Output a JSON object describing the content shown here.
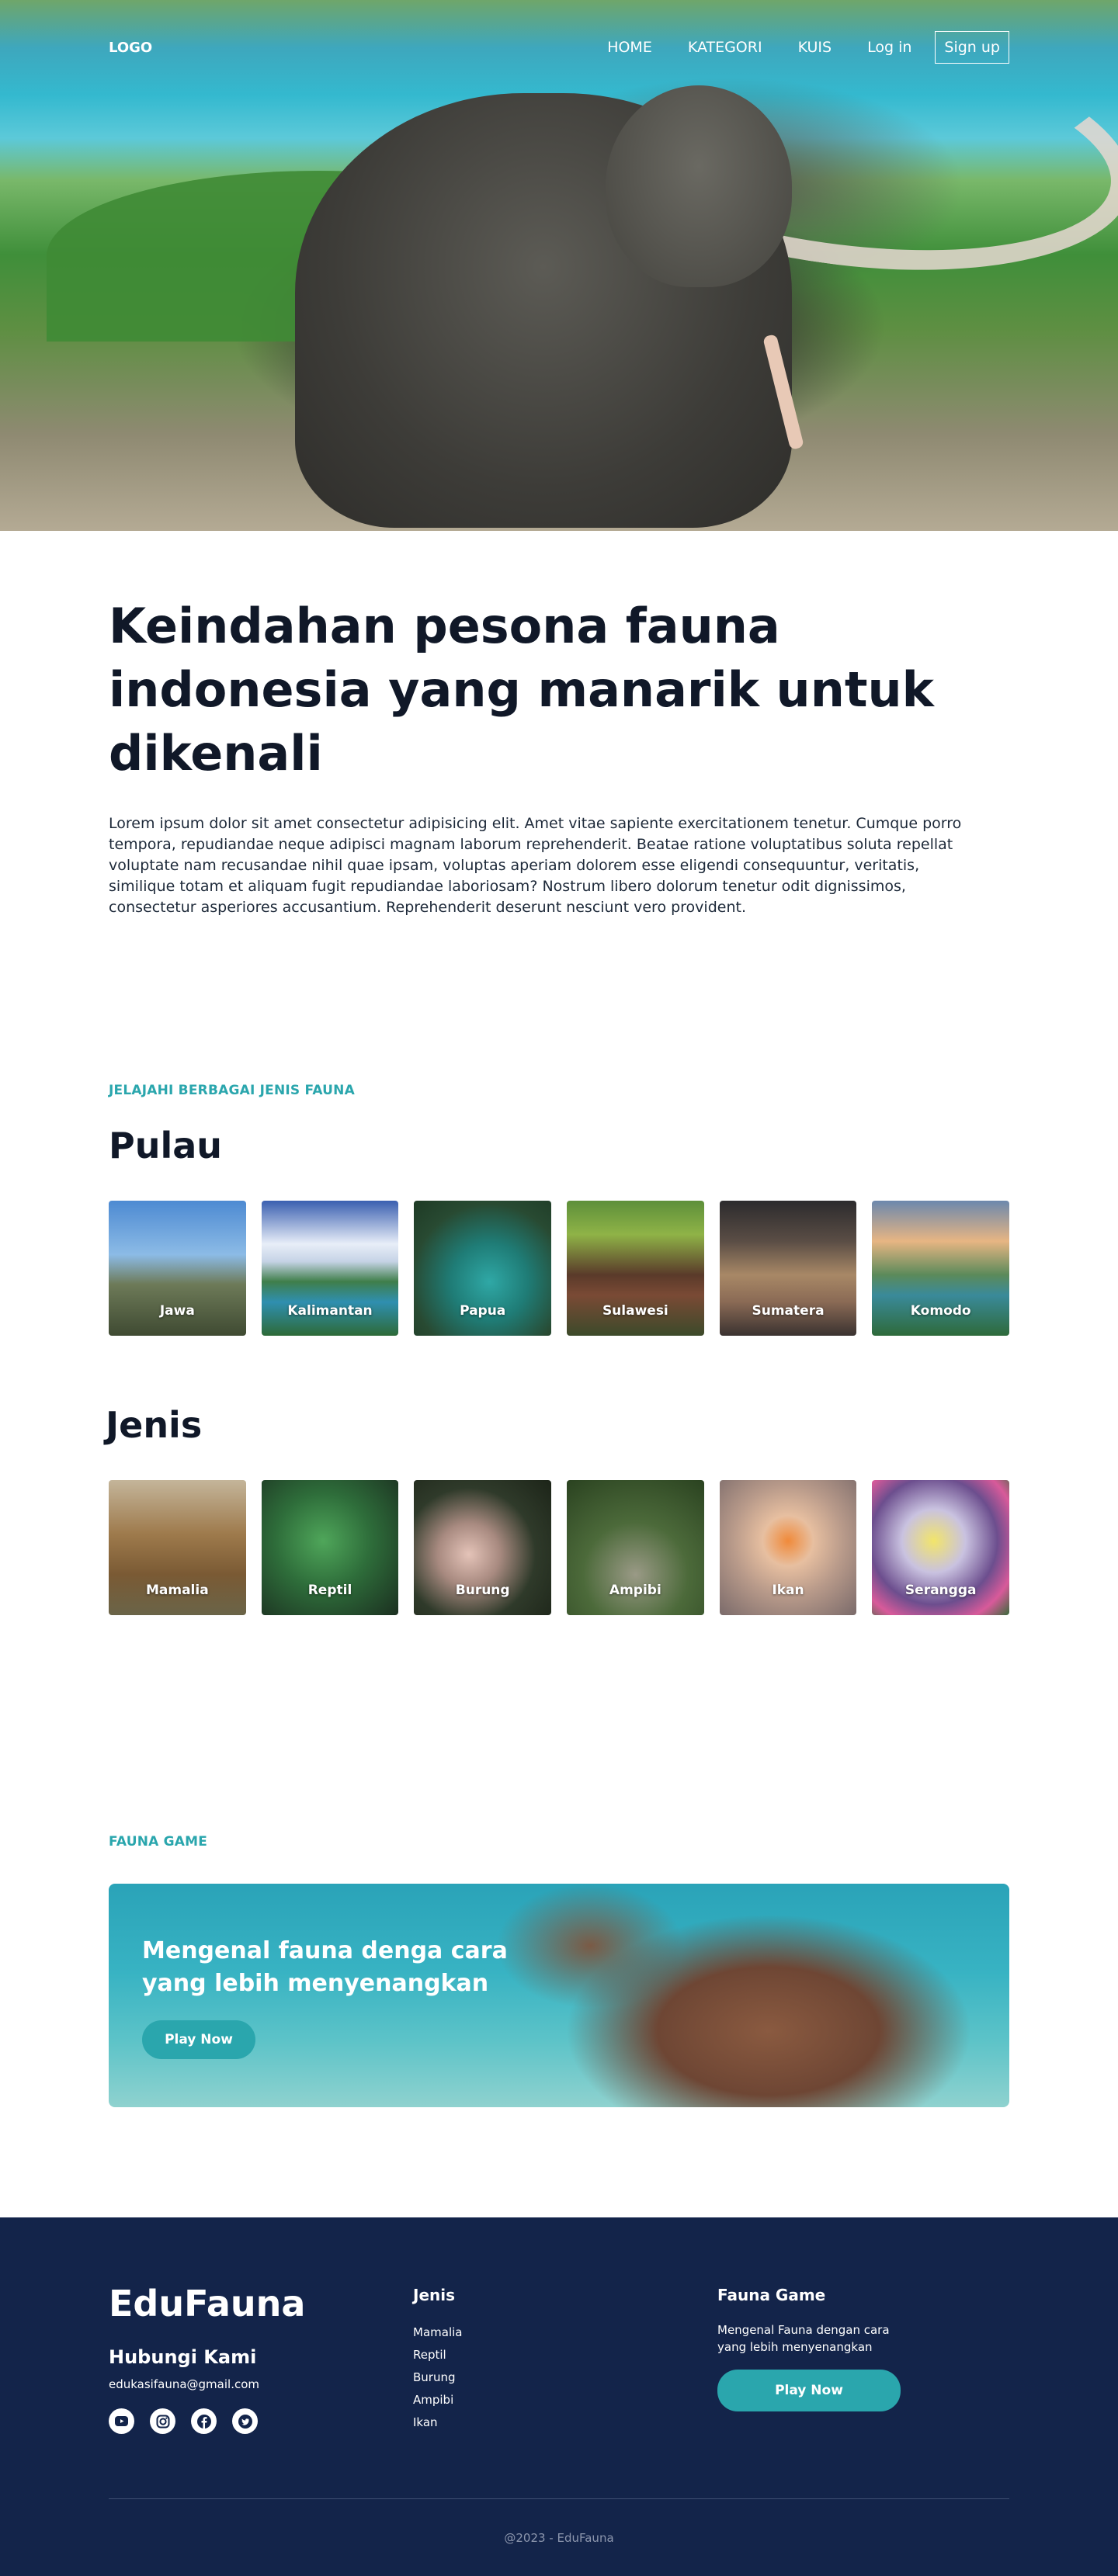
{
  "nav": {
    "logo": "LOGO",
    "items": [
      {
        "label": "HOME"
      },
      {
        "label": "KATEGORI"
      },
      {
        "label": "KUIS"
      },
      {
        "label": "Log in"
      }
    ],
    "signup": "Sign up"
  },
  "intro": {
    "title": "Keindahan pesona fauna indonesia yang manarik untuk dikenali",
    "body": "Lorem ipsum dolor sit amet consectetur adipisicing elit. Amet vitae sapiente exercitationem tenetur. Cumque porro tempora, repudiandae neque adipisci magnam laborum reprehenderit. Beatae ratione voluptatibus soluta repellat voluptate nam recusandae nihil quae ipsam, voluptas aperiam dolorem esse eligendi consequuntur, veritatis, similique totam et aliquam fugit repudiandae laboriosam? Nostrum libero dolorum tenetur odit dignissimos, consectetur asperiores accusantium. Reprehenderit deserunt nesciunt vero provident."
  },
  "categories": {
    "eyebrow": "JELAJAHI BERBAGAI JENIS FAUNA",
    "pulau_title": "Pulau",
    "pulau": [
      {
        "label": "Jawa"
      },
      {
        "label": "Kalimantan"
      },
      {
        "label": "Papua"
      },
      {
        "label": "Sulawesi"
      },
      {
        "label": "Sumatera"
      },
      {
        "label": "Komodo"
      }
    ],
    "jenis_title": "Jenis",
    "jenis": [
      {
        "label": "Mamalia"
      },
      {
        "label": "Reptil"
      },
      {
        "label": "Burung"
      },
      {
        "label": "Ampibi"
      },
      {
        "label": "Ikan"
      },
      {
        "label": "Serangga"
      }
    ]
  },
  "game": {
    "eyebrow": "FAUNA GAME",
    "headline": "Mengenal fauna denga cara yang lebih menyenangkan",
    "button": "Play Now"
  },
  "footer": {
    "brand": "EduFauna",
    "contact_heading": "Hubungi Kami",
    "email": "edukasifauna@gmail.com",
    "socials": [
      "youtube-icon",
      "instagram-icon",
      "facebook-icon",
      "twitter-icon"
    ],
    "jenis_heading": "Jenis",
    "jenis_links": [
      "Mamalia",
      "Reptil",
      "Burung",
      "Ampibi",
      "Ikan"
    ],
    "game_heading": "Fauna Game",
    "game_desc": "Mengenal Fauna dengan cara yang lebih menyenangkan",
    "game_button": "Play Now",
    "copyright": "@2023 - EduFauna"
  },
  "colors": {
    "accent": "#2aa6ad",
    "footer_bg": "#13244a",
    "heading": "#101828"
  }
}
